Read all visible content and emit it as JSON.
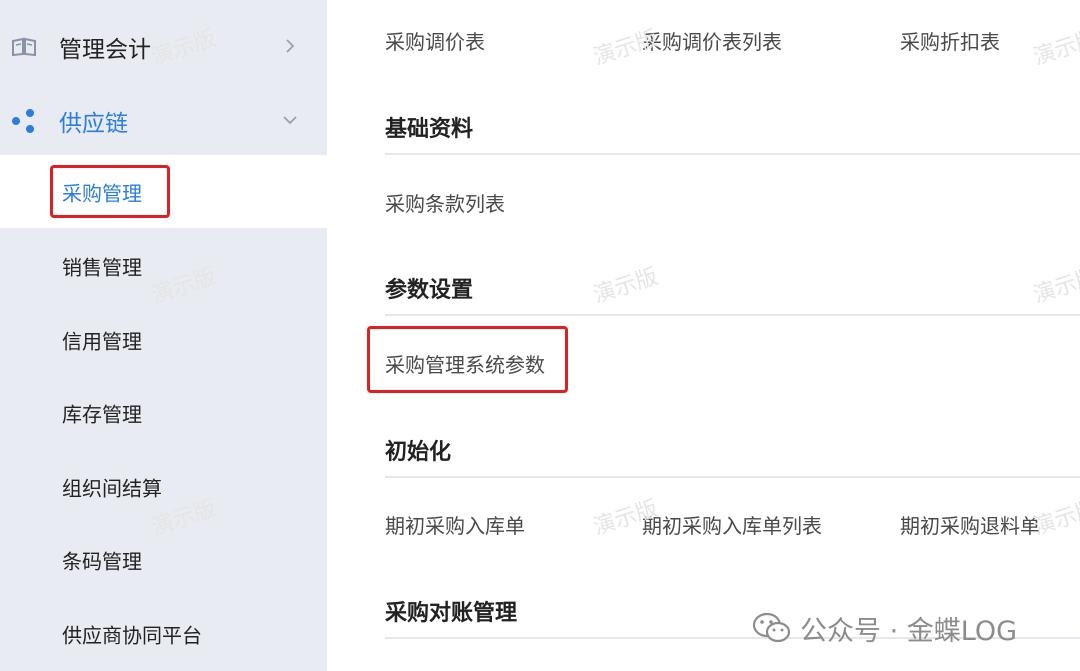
{
  "sidebar": {
    "groups": [
      {
        "label": "管理会计",
        "icon": "book-icon",
        "expanded": false
      },
      {
        "label": "供应链",
        "icon": "nodes-icon",
        "expanded": true
      }
    ],
    "sub_items": [
      {
        "label": "采购管理",
        "active": true
      },
      {
        "label": "销售管理"
      },
      {
        "label": "信用管理"
      },
      {
        "label": "库存管理"
      },
      {
        "label": "组织间结算"
      },
      {
        "label": "条码管理"
      },
      {
        "label": "供应商协同平台"
      }
    ],
    "accent_color": "#2a7de1"
  },
  "main": {
    "top_links": [
      "采购调价表",
      "采购调价表列表",
      "采购折扣表"
    ],
    "sections": [
      {
        "title": "基础资料",
        "items": [
          "采购条款列表"
        ]
      },
      {
        "title": "参数设置",
        "items": [
          "采购管理系统参数"
        ]
      },
      {
        "title": "初始化",
        "items": [
          "期初采购入库单",
          "期初采购入库单列表",
          "期初采购退料单"
        ]
      },
      {
        "title": "采购对账管理",
        "items": []
      }
    ]
  },
  "watermark": "演示版",
  "footer": {
    "wechat_label": "公众号 · 金蝶LOG"
  },
  "highlight_color": "#e02020"
}
